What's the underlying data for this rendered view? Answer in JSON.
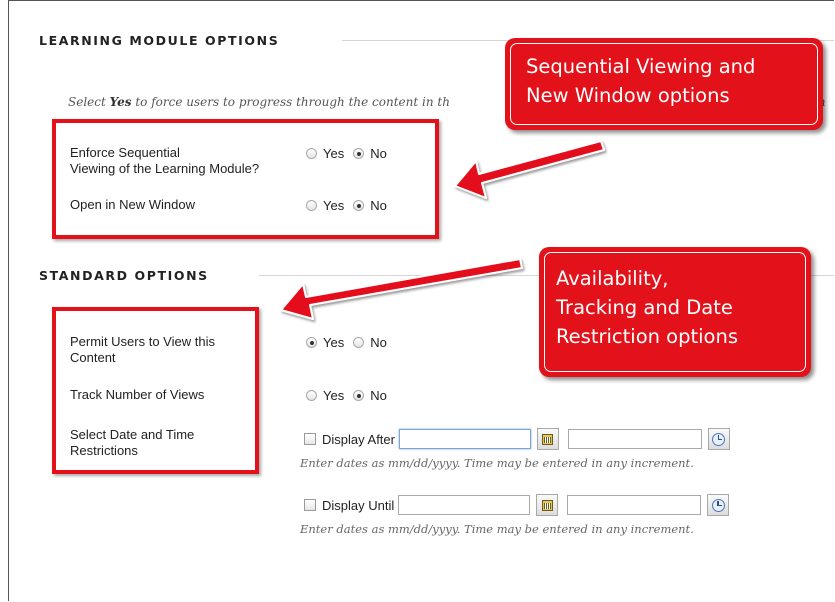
{
  "learning_module": {
    "title": "LEARNING MODULE OPTIONS",
    "intro": {
      "pre": "Select ",
      "bold": "Yes",
      "post": " to force users to progress through the content in th",
      "tail": "h"
    },
    "enforce_sequential": {
      "label_line1": "Enforce Sequential",
      "label_line2": "Viewing of the Learning Module?",
      "yes": "Yes",
      "no": "No",
      "selected": "No"
    },
    "new_window": {
      "label": "Open in New Window",
      "yes": "Yes",
      "no": "No",
      "selected": "No"
    }
  },
  "standard": {
    "title": "STANDARD OPTIONS",
    "permit_view": {
      "label_line1": "Permit Users to View this",
      "label_line2": "Content",
      "yes": "Yes",
      "no": "No",
      "selected": "Yes"
    },
    "track_views": {
      "label": "Track Number of Views",
      "yes": "Yes",
      "no": "No",
      "selected": "No"
    },
    "date_restrictions": {
      "label_line1": "Select Date and Time",
      "label_line2": "Restrictions",
      "display_after": "Display After",
      "display_until": "Display Until",
      "hint": "Enter dates as mm/dd/yyyy. Time may be entered in any increment."
    }
  },
  "callouts": {
    "sequential": {
      "line1": "Sequential Viewing and",
      "line2": "New Window options"
    },
    "availability": {
      "line1": "Availability,",
      "line2": "Tracking and Date",
      "line3": "Restriction options"
    }
  },
  "colors": {
    "highlight": "#e3111a",
    "text": "#222222",
    "hint": "#666666"
  },
  "icons": [
    "calendar-icon",
    "clock-icon",
    "radio-button",
    "checkbox"
  ]
}
